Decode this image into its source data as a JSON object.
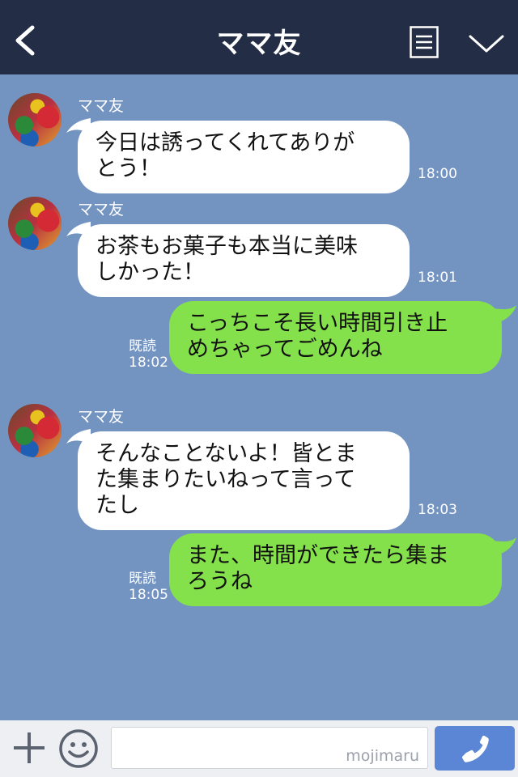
{
  "header": {
    "title": "ママ友"
  },
  "messages": [
    {
      "side": "in",
      "sender": "ママ友",
      "lines": [
        "今日は誘ってくれてありが",
        "とう！"
      ],
      "time": "18:00"
    },
    {
      "side": "in",
      "sender": "ママ友",
      "lines": [
        "お茶もお菓子も本当に美味",
        "しかった！"
      ],
      "time": "18:01"
    },
    {
      "side": "out",
      "read": "既読",
      "lines": [
        "こっちこそ長い時間引き止",
        "めちゃってごめんね"
      ],
      "time": "18:02"
    },
    {
      "side": "in",
      "sender": "ママ友",
      "lines": [
        "そんなことないよ！皆とま",
        "た集まりたいねって言って",
        "たし"
      ],
      "time": "18:03"
    },
    {
      "side": "out",
      "read": "既読",
      "lines": [
        "また、時間ができたら集ま",
        "ろうね"
      ],
      "time": "18:05"
    }
  ],
  "footer": {
    "watermark": "mojimaru"
  },
  "colors": {
    "header": "#232d45",
    "background": "#7393c1",
    "incoming": "#ffffff",
    "outgoing": "#84e14b",
    "send": "#5b86d6"
  }
}
